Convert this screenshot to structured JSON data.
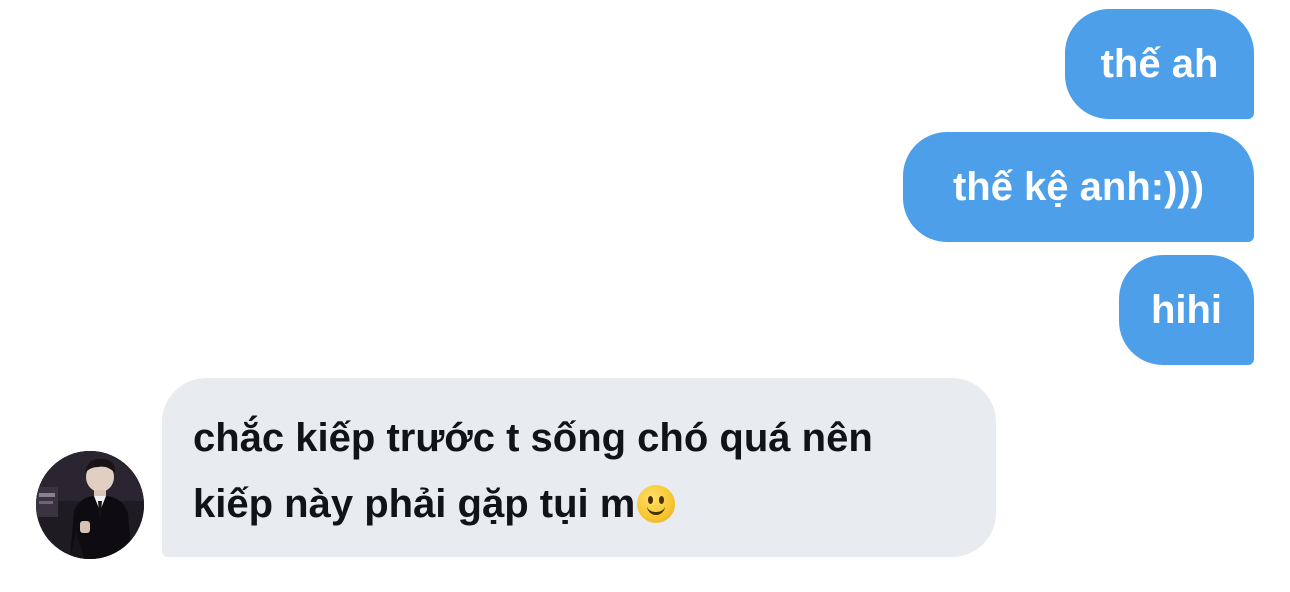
{
  "conversation": {
    "messages": [
      {
        "direction": "outgoing",
        "text": "thế ah"
      },
      {
        "direction": "outgoing",
        "text": "thế kệ anh:)))"
      },
      {
        "direction": "outgoing",
        "text": "hihi"
      },
      {
        "direction": "incoming",
        "lines": [
          "chắc kiếp trước t sống chó quá nên",
          "kiếp này phải gặp tụi m"
        ],
        "trailing_emoji": "slightly-smiling-face-emoji"
      }
    ],
    "sender_avatar": {
      "icon": "person-avatar-photo"
    }
  },
  "colors": {
    "outgoing_bubble": "#4d9fea",
    "outgoing_text": "#ffffff",
    "incoming_bubble": "#e8ecf0",
    "incoming_text": "#0f1419",
    "background": "#ffffff"
  }
}
